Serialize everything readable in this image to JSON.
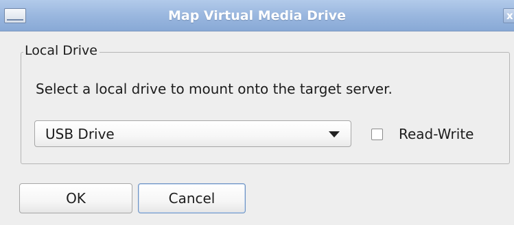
{
  "window": {
    "title": "Map Virtual Media Drive",
    "close_glyph": "x",
    "app_icon": "window-icon",
    "close_icon": "close-icon"
  },
  "local_drive": {
    "group_label": "Local Drive",
    "instructions": "Select a local drive to mount onto the target server.",
    "drive_select": {
      "selected": "USB Drive",
      "arrow_icon": "chevron-down-icon"
    },
    "read_write": {
      "label": "Read-Write",
      "checked": false
    }
  },
  "buttons": {
    "ok_label": "OK",
    "cancel_label": "Cancel"
  },
  "colors": {
    "titlebar": "#9ab7df",
    "title_text": "#ffffff",
    "dialog_background": "#eeeeee",
    "focus_border": "#6e93c4"
  }
}
